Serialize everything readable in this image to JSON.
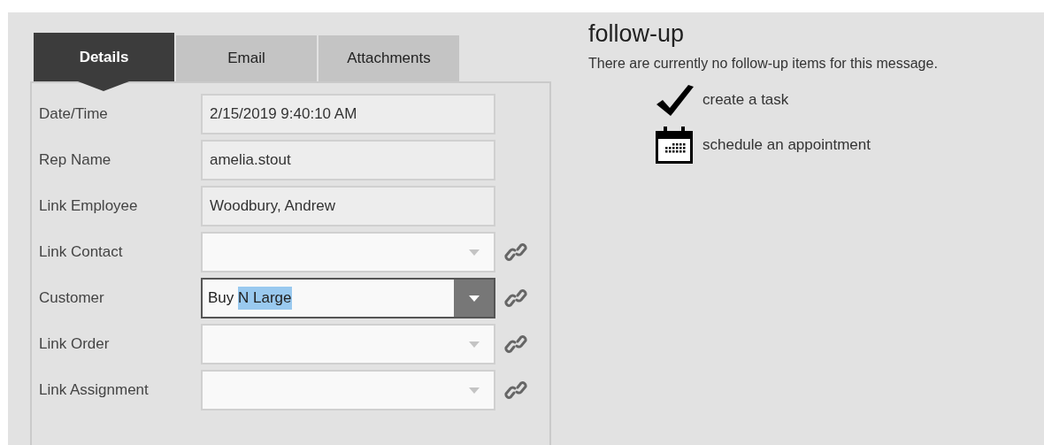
{
  "tabs": [
    {
      "label": "Details",
      "selected": true
    },
    {
      "label": "Email",
      "selected": false
    },
    {
      "label": "Attachments",
      "selected": false
    }
  ],
  "fields": [
    {
      "kind": "text",
      "label": "Date/Time",
      "value": "2/15/2019 9:40:10 AM"
    },
    {
      "kind": "text",
      "label": "Rep Name",
      "value": "amelia.stout"
    },
    {
      "kind": "text",
      "label": "Link Employee",
      "value": "Woodbury, Andrew"
    },
    {
      "kind": "combo",
      "label": "Link Contact",
      "focused": false
    },
    {
      "kind": "combo",
      "label": "Customer",
      "value": "Buy ",
      "selection": "N Large",
      "focused": true
    },
    {
      "kind": "combo",
      "label": "Link Order",
      "focused": false
    },
    {
      "kind": "combo",
      "label": "Link Assignment",
      "focused": false
    }
  ],
  "follow_up": {
    "title": "follow-up",
    "message": "There are currently no follow-up items for this message.",
    "actions": [
      {
        "kind": "task",
        "label": "create a task"
      },
      {
        "kind": "appointment",
        "label": "schedule an appointment"
      }
    ]
  }
}
